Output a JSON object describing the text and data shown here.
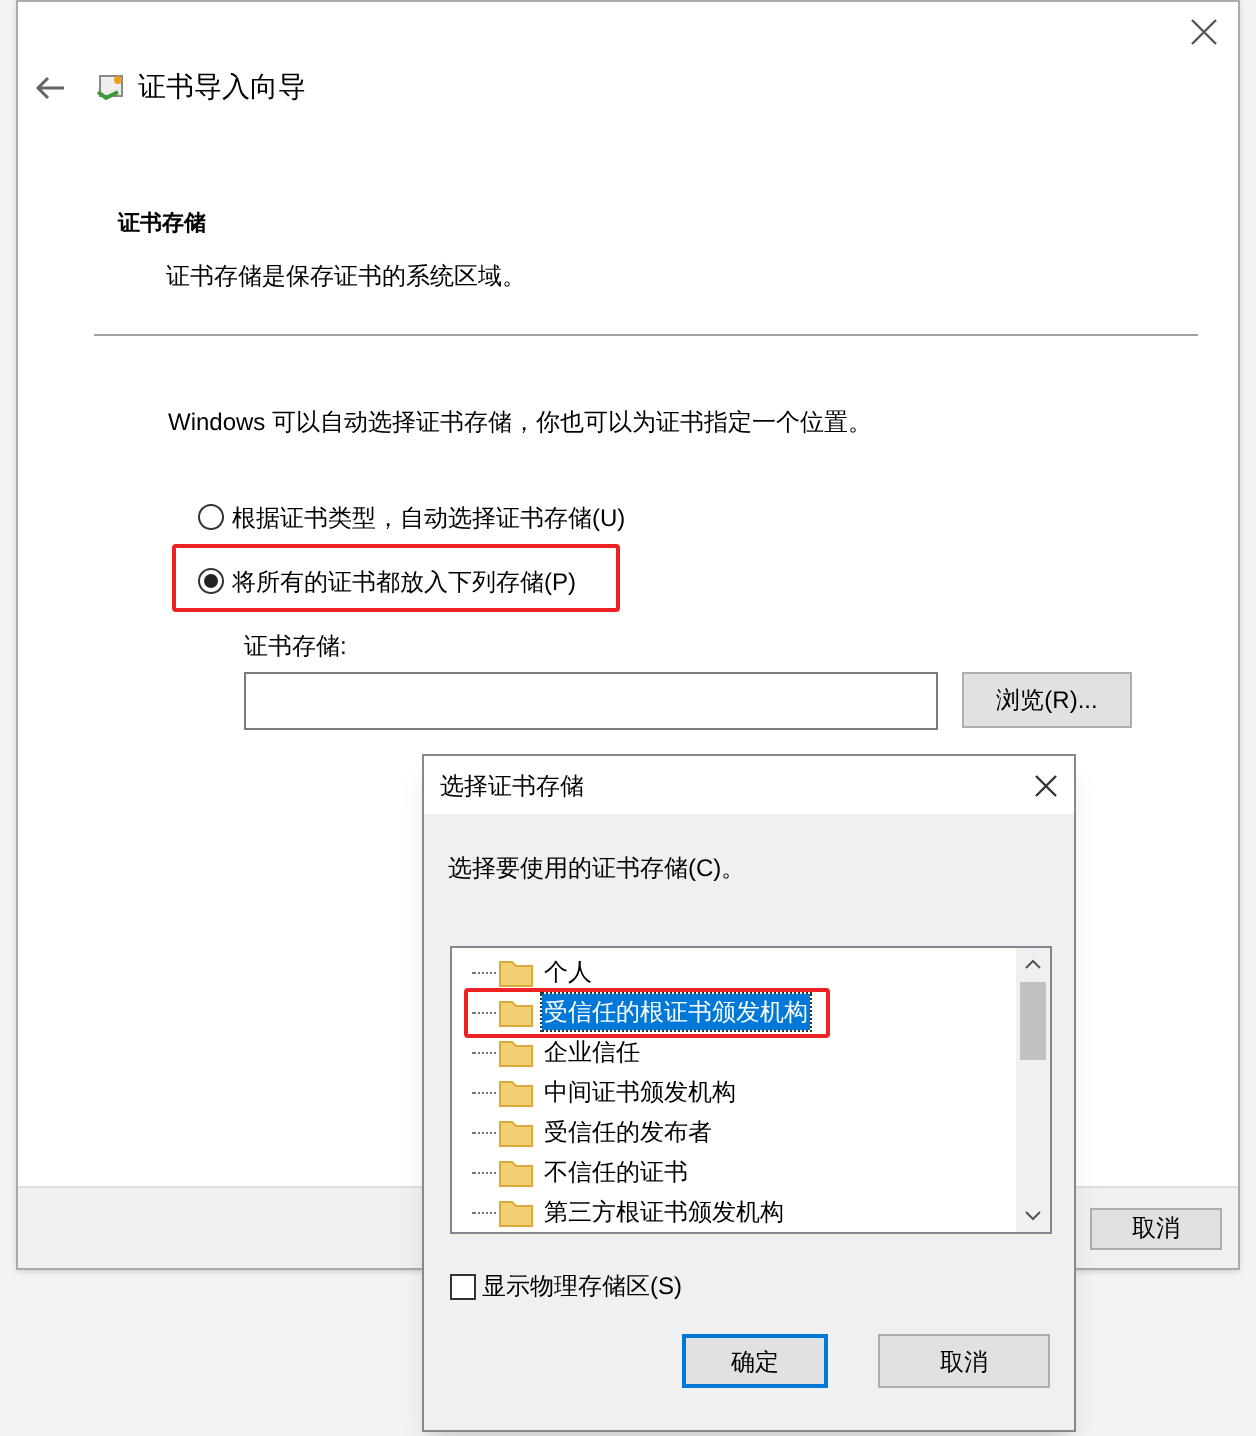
{
  "wizard": {
    "title": "证书导入向导",
    "section_title": "证书存储",
    "section_desc": "证书存储是保存证书的系统区域。",
    "intro": "Windows 可以自动选择证书存储，你也可以为证书指定一个位置。",
    "options": [
      {
        "label": "根据证书类型，自动选择证书存储(U)",
        "selected": false,
        "highlighted": false
      },
      {
        "label": "将所有的证书都放入下列存储(P)",
        "selected": true,
        "highlighted": true
      }
    ],
    "store_label": "证书存储:",
    "browse_button": "浏览(R)...",
    "cancel_button": "取消"
  },
  "dialog": {
    "title": "选择证书存储",
    "prompt": "选择要使用的证书存储(C)。",
    "stores": [
      {
        "label": "个人",
        "selected": false,
        "highlighted": false
      },
      {
        "label": "受信任的根证书颁发机构",
        "selected": true,
        "highlighted": true
      },
      {
        "label": "企业信任",
        "selected": false,
        "highlighted": false
      },
      {
        "label": "中间证书颁发机构",
        "selected": false,
        "highlighted": false
      },
      {
        "label": "受信任的发布者",
        "selected": false,
        "highlighted": false
      },
      {
        "label": "不信任的证书",
        "selected": false,
        "highlighted": false
      },
      {
        "label": "第三方根证书颁发机构",
        "selected": false,
        "highlighted": false
      }
    ],
    "show_physical": {
      "label": "显示物理存储区(S)",
      "checked": false
    },
    "ok_button": "确定",
    "cancel_button": "取消"
  }
}
